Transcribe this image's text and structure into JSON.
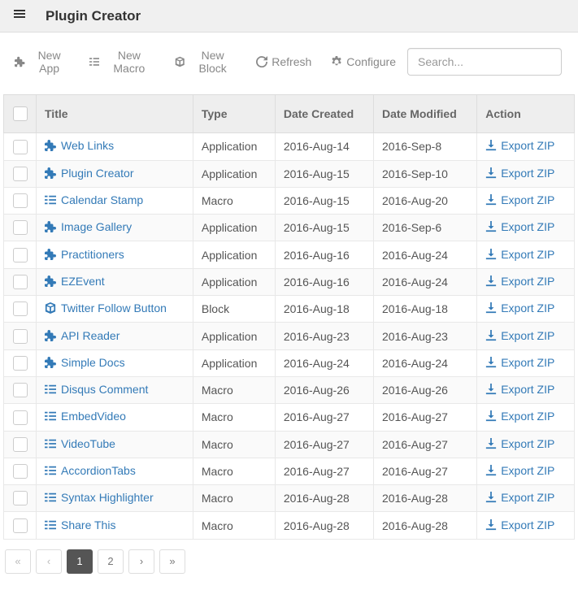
{
  "header": {
    "title": "Plugin Creator"
  },
  "toolbar": {
    "new_app": "New App",
    "new_macro": "New Macro",
    "new_block": "New Block",
    "refresh": "Refresh",
    "configure": "Configure"
  },
  "search": {
    "placeholder": "Search..."
  },
  "table": {
    "headers": {
      "title": "Title",
      "type": "Type",
      "created": "Date Created",
      "modified": "Date Modified",
      "action": "Action"
    },
    "action_label": "Export ZIP",
    "rows": [
      {
        "icon": "puzzle",
        "title": "Web Links",
        "type": "Application",
        "created": "2016-Aug-14",
        "modified": "2016-Sep-8"
      },
      {
        "icon": "puzzle",
        "title": "Plugin Creator",
        "type": "Application",
        "created": "2016-Aug-15",
        "modified": "2016-Sep-10"
      },
      {
        "icon": "list",
        "title": "Calendar Stamp",
        "type": "Macro",
        "created": "2016-Aug-15",
        "modified": "2016-Aug-20"
      },
      {
        "icon": "puzzle",
        "title": "Image Gallery",
        "type": "Application",
        "created": "2016-Aug-15",
        "modified": "2016-Sep-6"
      },
      {
        "icon": "puzzle",
        "title": "Practitioners",
        "type": "Application",
        "created": "2016-Aug-16",
        "modified": "2016-Aug-24"
      },
      {
        "icon": "puzzle",
        "title": "EZEvent",
        "type": "Application",
        "created": "2016-Aug-16",
        "modified": "2016-Aug-24"
      },
      {
        "icon": "cube",
        "title": "Twitter Follow Button",
        "type": "Block",
        "created": "2016-Aug-18",
        "modified": "2016-Aug-18"
      },
      {
        "icon": "puzzle",
        "title": "API Reader",
        "type": "Application",
        "created": "2016-Aug-23",
        "modified": "2016-Aug-23"
      },
      {
        "icon": "puzzle",
        "title": "Simple Docs",
        "type": "Application",
        "created": "2016-Aug-24",
        "modified": "2016-Aug-24"
      },
      {
        "icon": "list",
        "title": "Disqus Comment",
        "type": "Macro",
        "created": "2016-Aug-26",
        "modified": "2016-Aug-26"
      },
      {
        "icon": "list",
        "title": "EmbedVideo",
        "type": "Macro",
        "created": "2016-Aug-27",
        "modified": "2016-Aug-27"
      },
      {
        "icon": "list",
        "title": "VideoTube",
        "type": "Macro",
        "created": "2016-Aug-27",
        "modified": "2016-Aug-27"
      },
      {
        "icon": "list",
        "title": "AccordionTabs",
        "type": "Macro",
        "created": "2016-Aug-27",
        "modified": "2016-Aug-27"
      },
      {
        "icon": "list",
        "title": "Syntax Highlighter",
        "type": "Macro",
        "created": "2016-Aug-28",
        "modified": "2016-Aug-28"
      },
      {
        "icon": "list",
        "title": "Share This",
        "type": "Macro",
        "created": "2016-Aug-28",
        "modified": "2016-Aug-28"
      }
    ]
  },
  "pagination": {
    "pages": [
      "1",
      "2"
    ],
    "active": "1"
  }
}
